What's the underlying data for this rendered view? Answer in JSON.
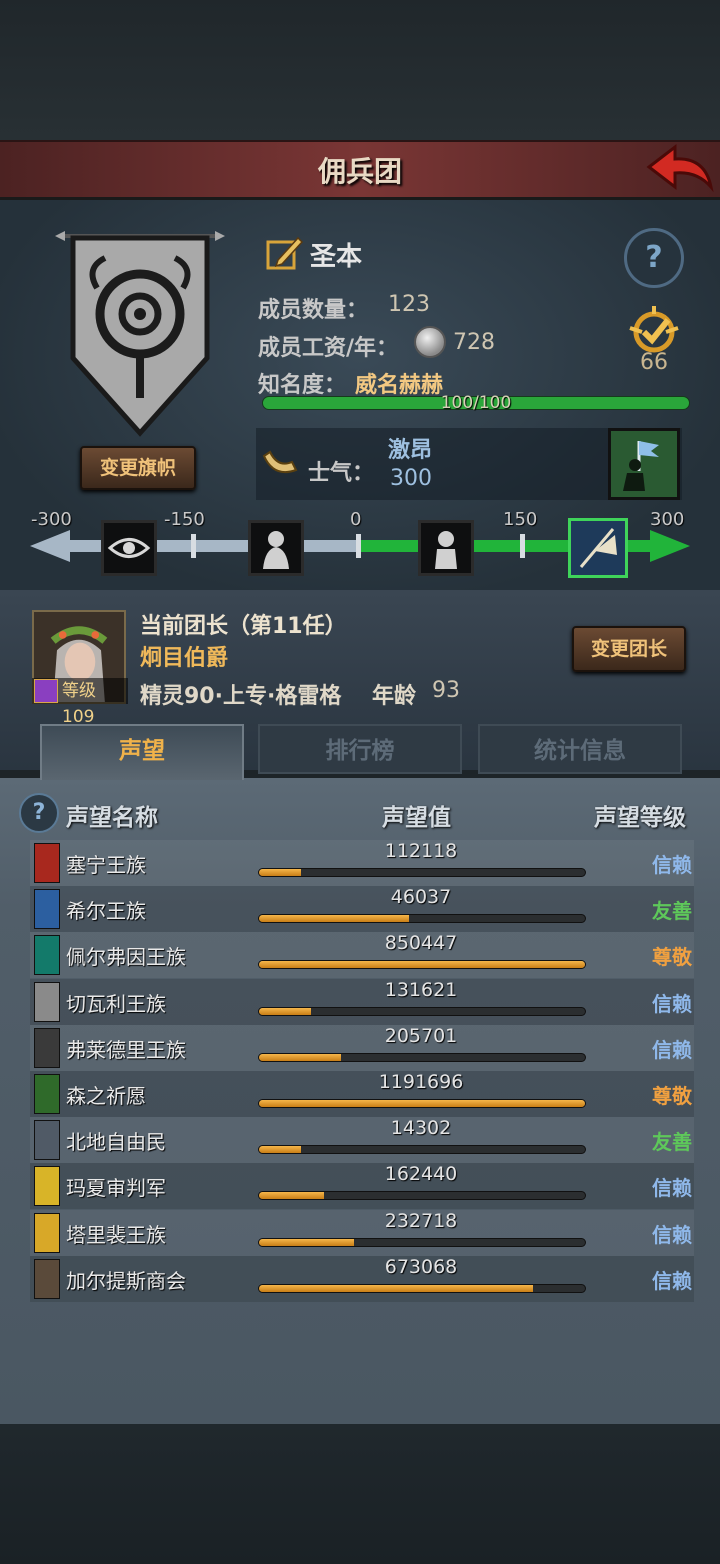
{
  "header": {
    "title": "佣兵团"
  },
  "guild": {
    "name": "圣本",
    "change_flag_label": "变更旗帜",
    "members_label": "成员数量：",
    "members": "123",
    "wage_label": "成员工资/年：",
    "wage": "728",
    "reputation_label": "知名度：",
    "reputation_state": "威名赫赫",
    "reputation_progress": "100/100",
    "reputation_fraction": 1.0,
    "medal_value": "66"
  },
  "morale": {
    "label": "士气：",
    "state": "激昂",
    "value": "300",
    "value_number": 300,
    "ticks": [
      "-300",
      "-150",
      "0",
      "150",
      "300"
    ],
    "icons": [
      "eye-icon",
      "grieving-figure-icon",
      "seated-figure-icon",
      "banner-charge-icon"
    ]
  },
  "leader": {
    "title": "当前团长（第11任）",
    "name": "炯目伯爵",
    "level": "等级109",
    "race": "精灵90·上专·格雷格",
    "age_label": "年龄",
    "age": "93",
    "change_leader_label": "变更团长"
  },
  "tabs": [
    {
      "label": "声望",
      "active": true
    },
    {
      "label": "排行榜",
      "active": false
    },
    {
      "label": "统计信息",
      "active": false
    }
  ],
  "list": {
    "headers": {
      "name": "声望名称",
      "value": "声望值",
      "level": "声望等级"
    },
    "level_colors": {
      "信赖": "#8fb8ea",
      "友善": "#5ec85a",
      "尊敬": "#f0a040"
    },
    "factions": [
      {
        "name": "塞宁王族",
        "value": "112118",
        "fill": 0.13,
        "level": "信赖",
        "icon_color": "#a8281e"
      },
      {
        "name": "希尔王族",
        "value": "46037",
        "fill": 0.46,
        "level": "友善",
        "icon_color": "#2c5fa0"
      },
      {
        "name": "佩尔弗因王族",
        "value": "850447",
        "fill": 1.0,
        "level": "尊敬",
        "icon_color": "#137a6a"
      },
      {
        "name": "切瓦利王族",
        "value": "131621",
        "fill": 0.16,
        "level": "信赖",
        "icon_color": "#8a8a8a"
      },
      {
        "name": "弗莱德里王族",
        "value": "205701",
        "fill": 0.25,
        "level": "信赖",
        "icon_color": "#3a3a3a"
      },
      {
        "name": "森之祈愿",
        "value": "1191696",
        "fill": 1.0,
        "level": "尊敬",
        "icon_color": "#2f6a2a"
      },
      {
        "name": "北地自由民",
        "value": "14302",
        "fill": 0.13,
        "level": "友善",
        "icon_color": "#505a66"
      },
      {
        "name": "玛夏审判军",
        "value": "162440",
        "fill": 0.2,
        "level": "信赖",
        "icon_color": "#d8b428"
      },
      {
        "name": "塔里裴王族",
        "value": "232718",
        "fill": 0.29,
        "level": "信赖",
        "icon_color": "#d8a828"
      },
      {
        "name": "加尔提斯商会",
        "value": "673068",
        "fill": 0.84,
        "level": "信赖",
        "icon_color": "#5a4a3a"
      }
    ]
  }
}
